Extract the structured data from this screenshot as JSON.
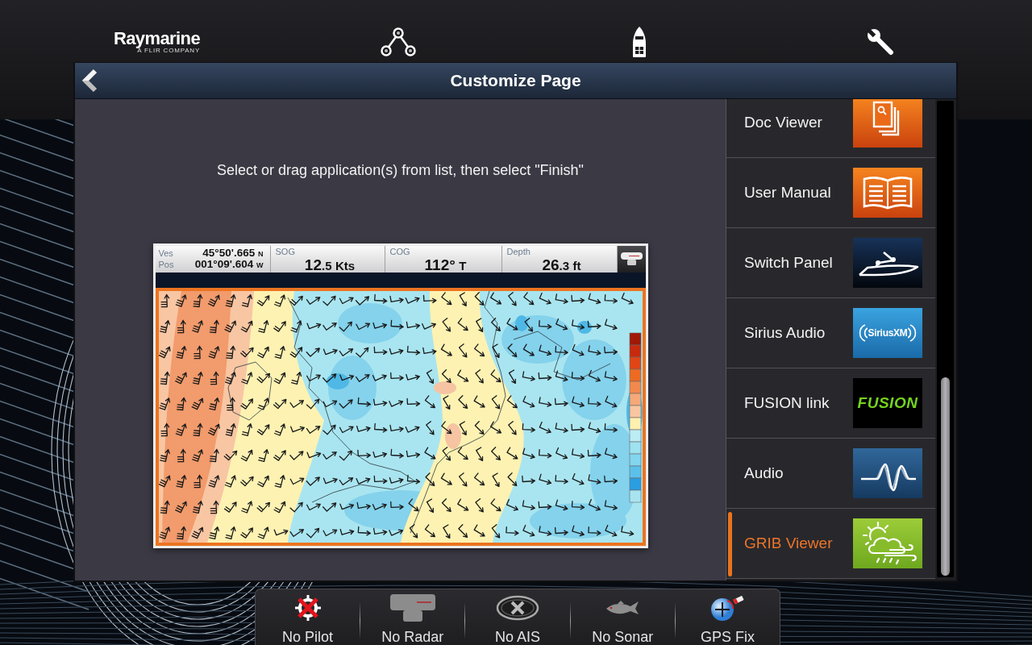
{
  "top_bar": {
    "logo": {
      "wordmark": "Raymarine",
      "tagline": "A FLIR COMPANY"
    }
  },
  "dialog": {
    "title": "Customize Page",
    "instruction": "Select or drag application(s) from list, then select \"Finish\"",
    "preview": {
      "data_bar": {
        "position": {
          "labels": [
            "Ves",
            "Pos"
          ],
          "latitude": {
            "value": "45°50'.665",
            "hemisphere": "N"
          },
          "longitude": {
            "value": "001°09'.604",
            "hemisphere": "W"
          }
        },
        "fields": [
          {
            "label": "SOG",
            "value": "12",
            "fraction": ".5",
            "unit": "Kts"
          },
          {
            "label": "COG",
            "value": "112°",
            "unit": "T"
          },
          {
            "label": "Depth",
            "value": "26",
            "fraction": ".3",
            "unit": "ft"
          }
        ]
      }
    }
  },
  "app_list": [
    {
      "label": "Doc Viewer",
      "kind": "doc-viewer",
      "selected": false
    },
    {
      "label": "User Manual",
      "kind": "user-manual",
      "selected": false
    },
    {
      "label": "Switch Panel",
      "kind": "switch-panel",
      "selected": false
    },
    {
      "label": "Sirius Audio",
      "kind": "sirius",
      "logo_text": "SiriusXM",
      "selected": false
    },
    {
      "label": "FUSION link",
      "kind": "fusion",
      "logo_text": "FUSION",
      "selected": false
    },
    {
      "label": "Audio",
      "kind": "audio",
      "selected": false
    },
    {
      "label": "GRIB Viewer",
      "kind": "grib",
      "selected": true
    }
  ],
  "status_bar": [
    {
      "label": "No Pilot",
      "kind": "pilot"
    },
    {
      "label": "No Radar",
      "kind": "radar"
    },
    {
      "label": "No AIS",
      "kind": "ais"
    },
    {
      "label": "No Sonar",
      "kind": "sonar"
    },
    {
      "label": "GPS Fix",
      "kind": "gps"
    }
  ]
}
